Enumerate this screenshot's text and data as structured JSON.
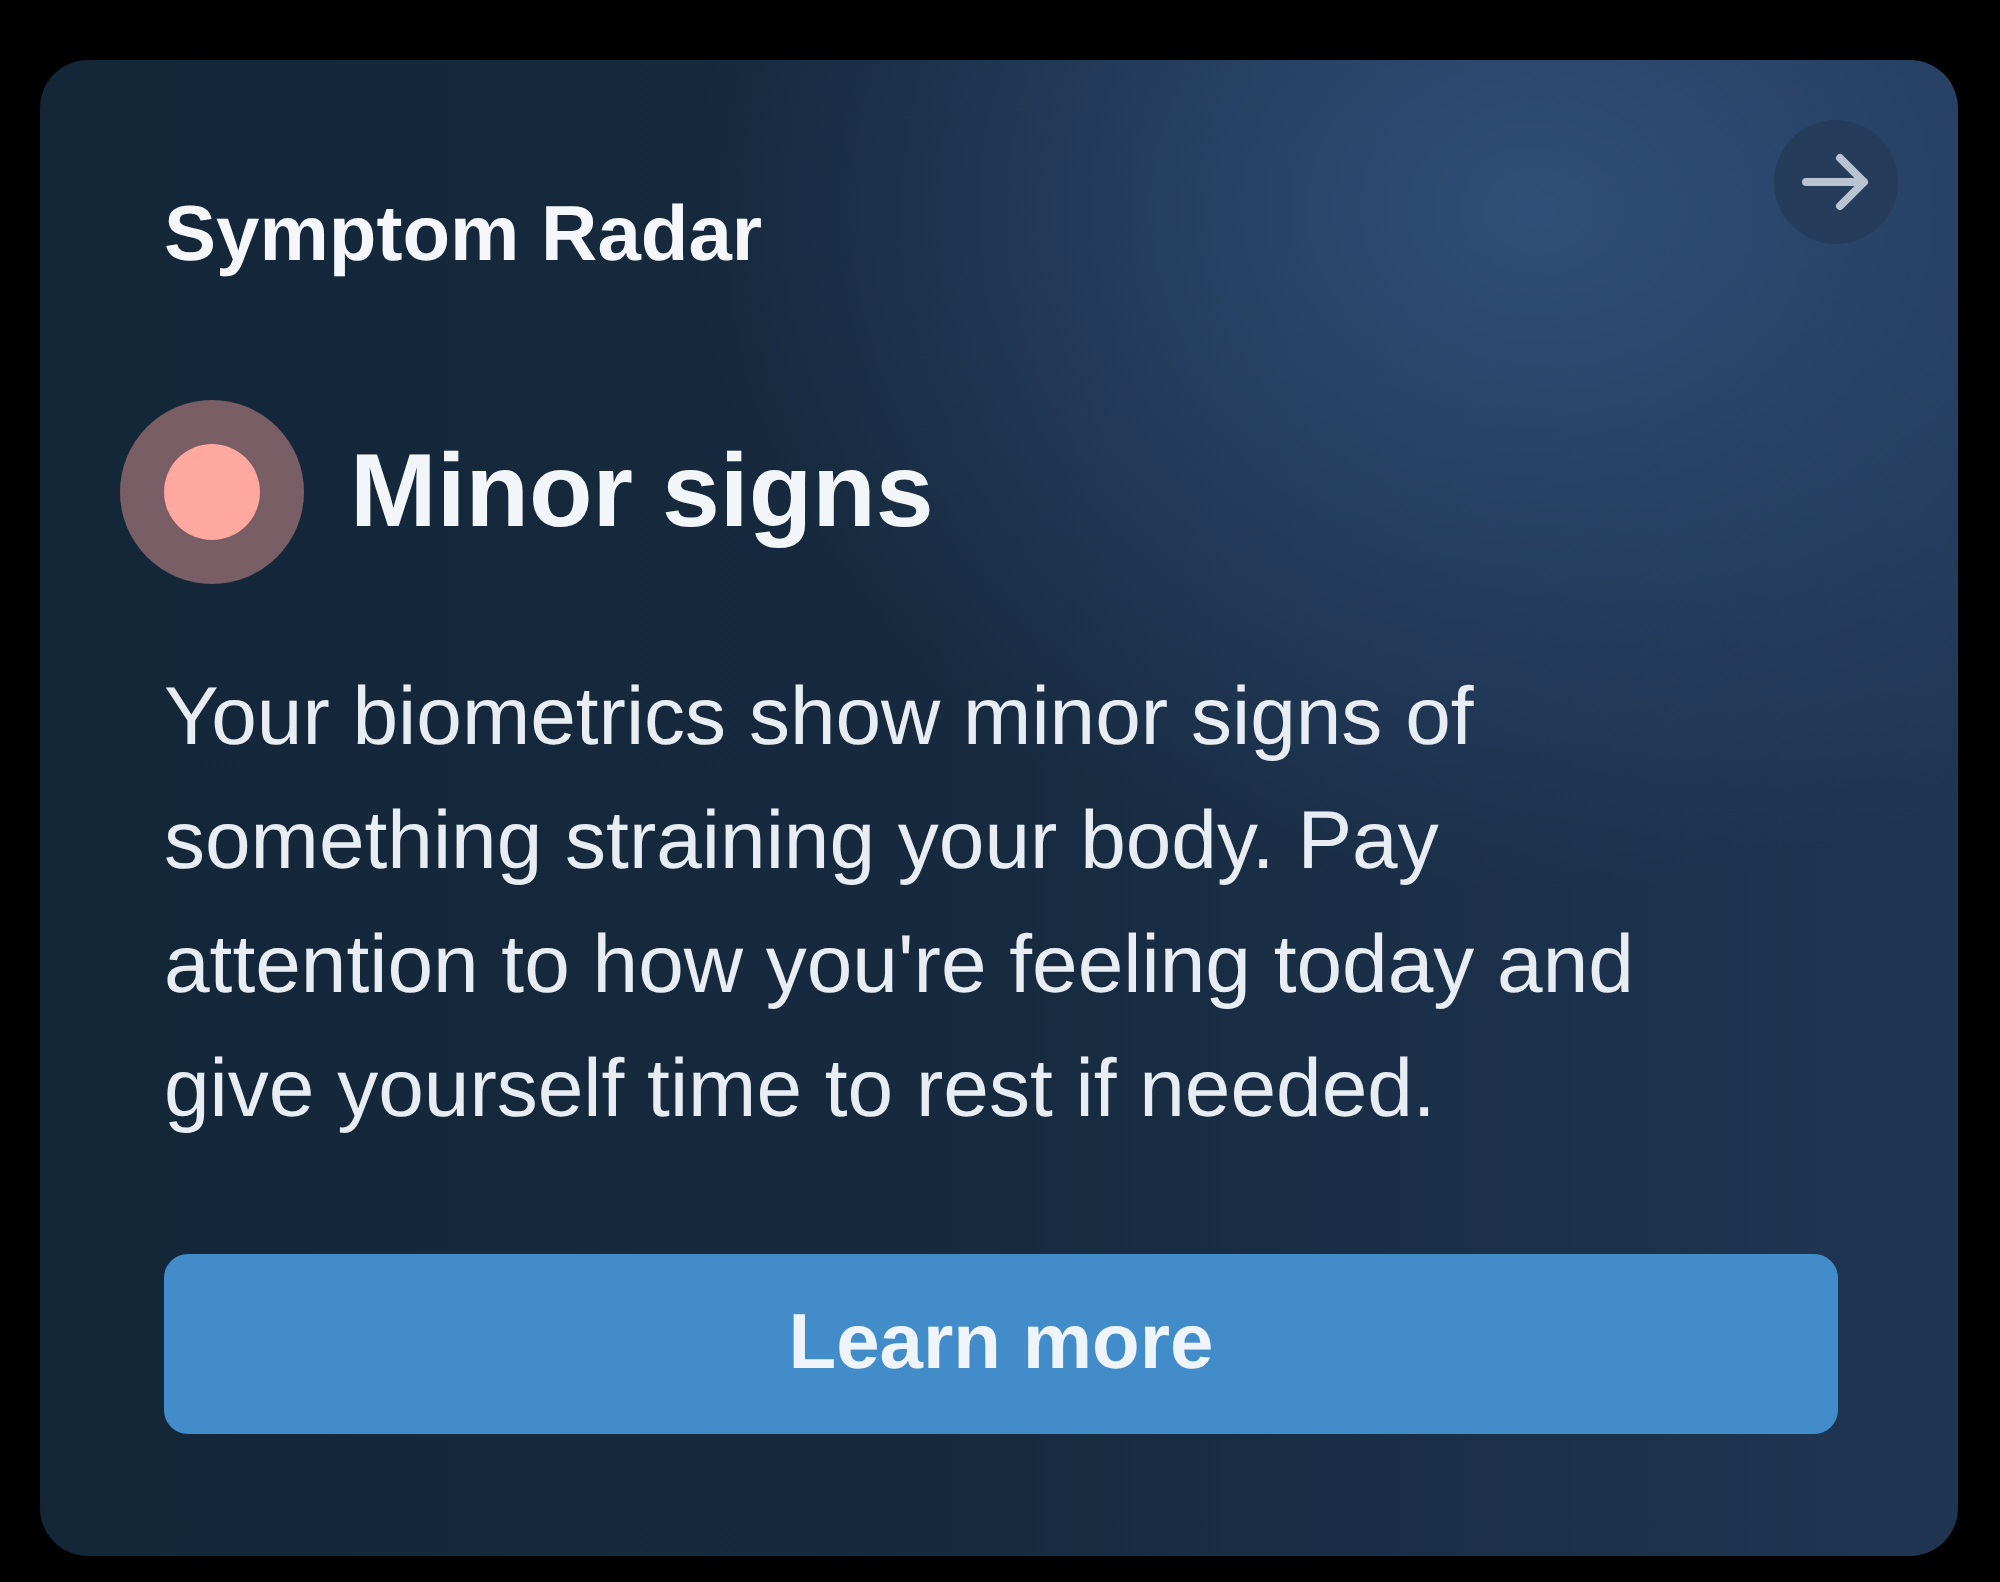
{
  "card": {
    "title": "Symptom Radar",
    "status": {
      "label": "Minor signs",
      "color": "#ffa89f"
    },
    "description": "Your biometrics show minor signs of something straining your body. Pay attention to how you're feeling today and give yourself time to rest if needed.",
    "button": {
      "label": "Learn more"
    }
  }
}
